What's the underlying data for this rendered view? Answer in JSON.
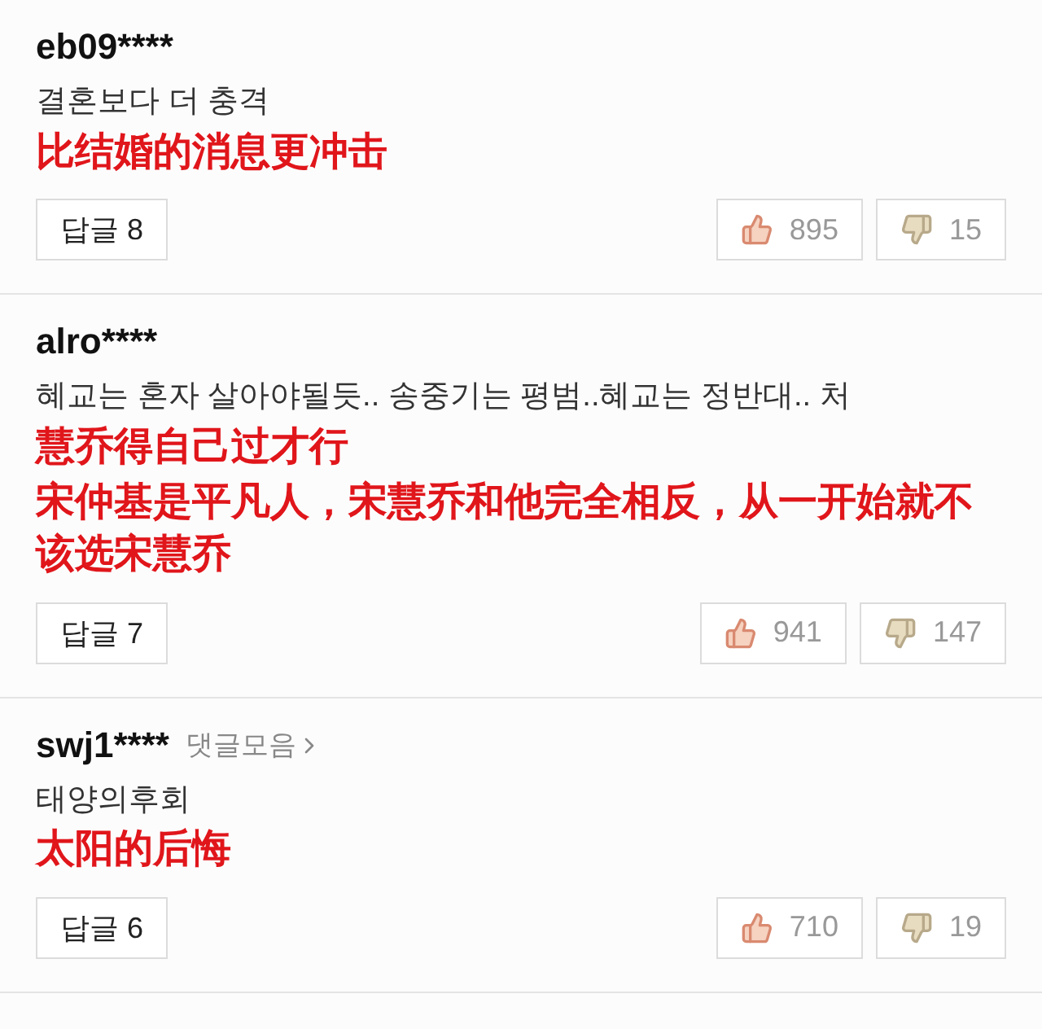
{
  "comments": [
    {
      "user": "eb09****",
      "body": "결혼보다 더 충격",
      "translation": "比结婚的消息更冲击",
      "reply": "답글 8",
      "likes": "895",
      "dislikes": "15"
    },
    {
      "user": "alro****",
      "body": "혜교는 혼자 살아야될듯.. 송중기는 평범..혜교는 정반대.. 처",
      "translation": [
        "慧乔得自己过才行",
        "宋仲基是平凡人，宋慧乔和他完全相反，从一开始就不该选宋慧乔"
      ],
      "reply": "답글 7",
      "likes": "941",
      "dislikes": "147"
    },
    {
      "user": "swj1****",
      "link": "댓글모음",
      "body": "태양의후회",
      "translation": "太阳的后悔",
      "reply": "답글 6",
      "likes": "710",
      "dislikes": "19"
    }
  ]
}
